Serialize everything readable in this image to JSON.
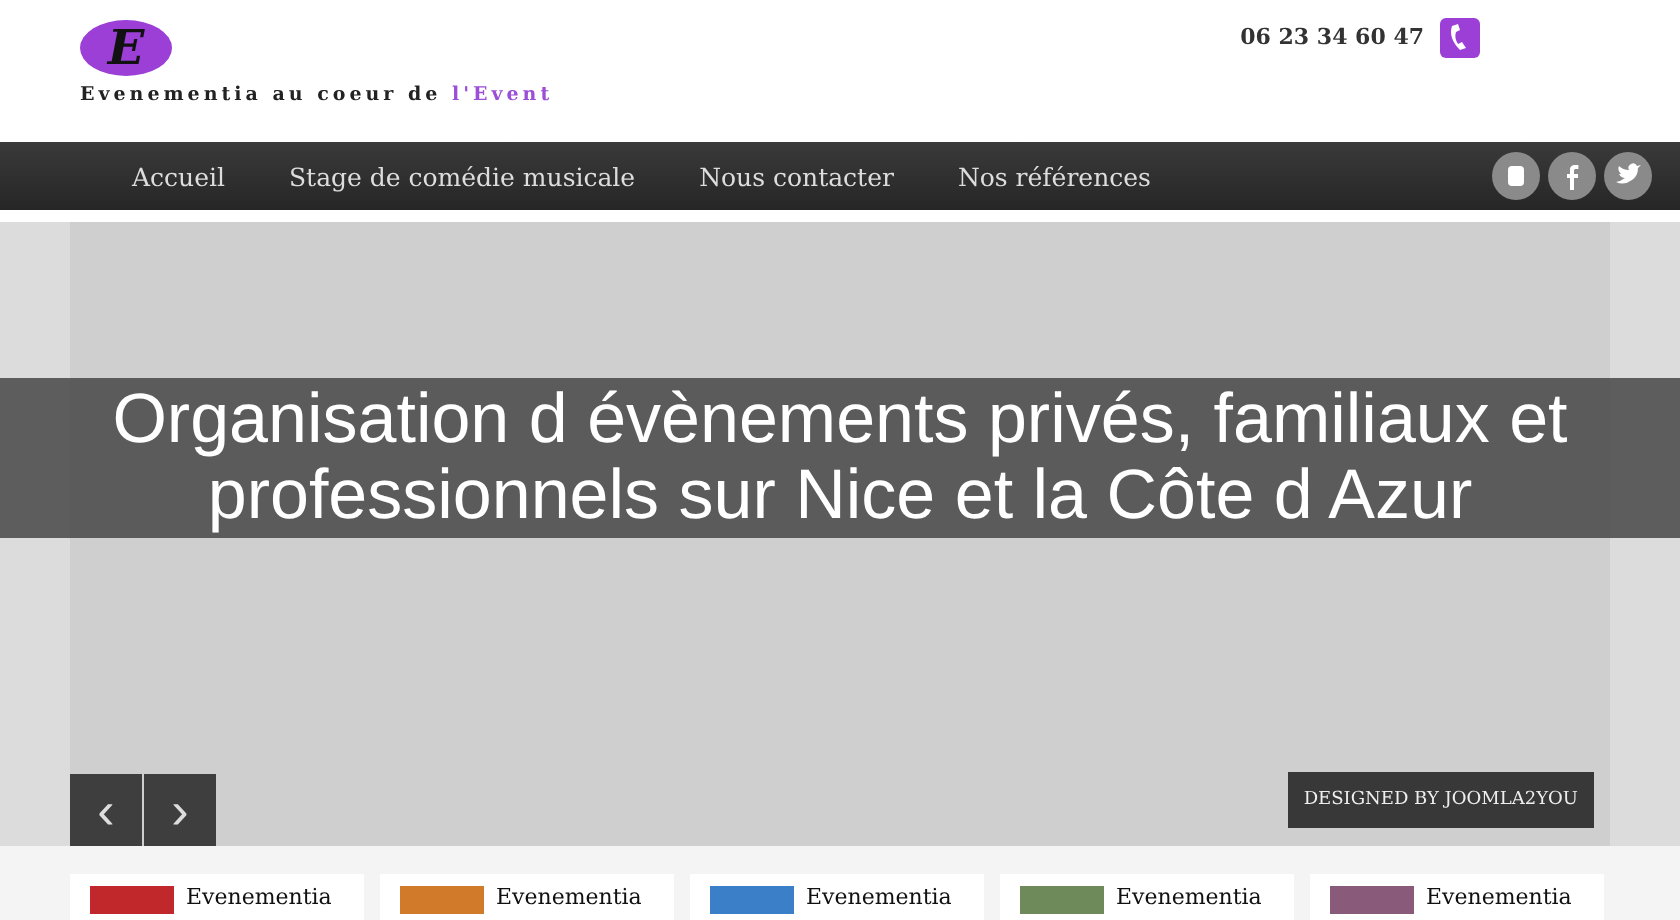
{
  "header": {
    "logo_letter": "E",
    "tagline": "Evenementia au coeur de **l'Event**",
    "phone": "06 23 34 60 47"
  },
  "nav": {
    "items": [
      {
        "label": "Accueil"
      },
      {
        "label": "Stage de comédie musicale"
      },
      {
        "label": "Nous contacter"
      },
      {
        "label": "Nos références"
      }
    ]
  },
  "slider": {
    "caption": "Organisation d évènements privés, familiaux et professionnels sur Nice et la Côte d Azur",
    "prev": "‹",
    "next": "›",
    "credit": "DESIGNED BY JOOMLA2YOU"
  },
  "cards": [
    {
      "title": "Evenementia",
      "color": "#c0282c"
    },
    {
      "title": "Evenementia",
      "color": "#d07a2a"
    },
    {
      "title": "Evenementia",
      "color": "#3a7fc8"
    },
    {
      "title": "Evenementia",
      "color": "#6e8a5a"
    },
    {
      "title": "Evenementia",
      "color": "#8a5a7a"
    }
  ]
}
